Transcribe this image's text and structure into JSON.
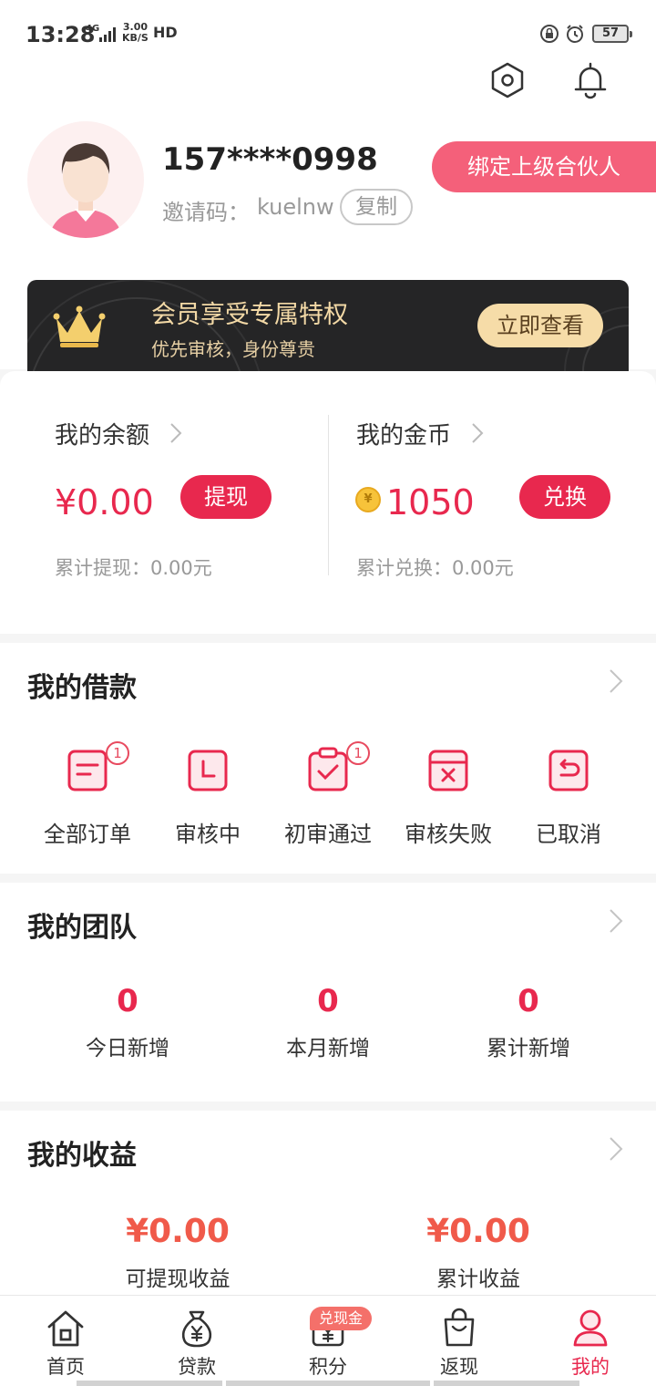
{
  "status_bar": {
    "time": "13:28",
    "network": "4G",
    "speed_value": "3.00",
    "speed_unit": "KB/S",
    "hd": "HD",
    "battery": "57"
  },
  "profile": {
    "phone": "157****0998",
    "invite_label": "邀请码：",
    "invite_code": "kuelnw",
    "copy_label": "复制",
    "bind_label": "绑定上级合伙人"
  },
  "vip_banner": {
    "title": "会员享受专属特权",
    "subtitle": "优先审核，身份尊贵",
    "button": "立即查看"
  },
  "wallet": {
    "balance": {
      "title": "我的余额",
      "value": "¥0.00",
      "button": "提现",
      "note": "累计提现：0.00元"
    },
    "coins": {
      "title": "我的金币",
      "value": "1050",
      "button": "兑换",
      "note": "累计兑换：0.00元",
      "coin_symbol": "¥"
    }
  },
  "loans": {
    "title": "我的借款",
    "items": [
      {
        "label": "全部订单",
        "badge": "1",
        "icon": "order-list-icon"
      },
      {
        "label": "审核中",
        "badge": "",
        "icon": "reviewing-icon"
      },
      {
        "label": "初审通过",
        "badge": "1",
        "icon": "approved-icon"
      },
      {
        "label": "审核失败",
        "badge": "",
        "icon": "failed-icon"
      },
      {
        "label": "已取消",
        "badge": "",
        "icon": "cancelled-icon"
      }
    ]
  },
  "team": {
    "title": "我的团队",
    "stats": [
      {
        "value": "0",
        "label": "今日新增"
      },
      {
        "value": "0",
        "label": "本月新增"
      },
      {
        "value": "0",
        "label": "累计新增"
      }
    ]
  },
  "income": {
    "title": "我的收益",
    "stats": [
      {
        "value": "¥0.00",
        "label": "可提现收益"
      },
      {
        "value": "¥0.00",
        "label": "累计收益"
      }
    ]
  },
  "tabbar": {
    "items": [
      {
        "label": "首页",
        "icon": "home-icon"
      },
      {
        "label": "贷款",
        "icon": "money-bag-icon"
      },
      {
        "label": "积分",
        "icon": "points-icon"
      },
      {
        "label": "返现",
        "icon": "shopping-bag-icon"
      },
      {
        "label": "我的",
        "icon": "user-icon"
      }
    ],
    "points_badge": "兑现金",
    "active": "我的"
  },
  "colors": {
    "accent": "#e8284e",
    "bind_pink": "#f4607a",
    "vip_bg": "#252526",
    "vip_gold": "#f6dca8",
    "income_red": "#f05a4a"
  }
}
